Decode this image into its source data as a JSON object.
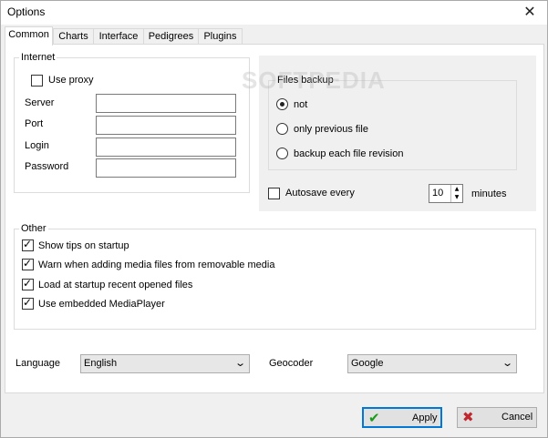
{
  "window": {
    "title": "Options"
  },
  "tabs": [
    "Common",
    "Charts",
    "Interface",
    "Pedigrees",
    "Plugins"
  ],
  "internet": {
    "label": "Internet",
    "use_proxy": "Use proxy",
    "server": "Server",
    "port": "Port",
    "login": "Login",
    "password": "Password"
  },
  "files_backup": {
    "label": "Files backup",
    "options": [
      "not",
      "only previous file",
      "backup each file revision"
    ],
    "selected": "not"
  },
  "autosave": {
    "label": "Autosave every",
    "value": "10",
    "unit": "minutes"
  },
  "other": {
    "label": "Other",
    "items": [
      "Show tips on startup",
      "Warn when adding media files from removable media",
      "Load at startup recent opened files",
      "Use embedded MediaPlayer"
    ]
  },
  "language": {
    "label": "Language",
    "value": "English"
  },
  "geocoder": {
    "label": "Geocoder",
    "value": "Google"
  },
  "buttons": {
    "apply": "Apply",
    "cancel": "Cancel"
  },
  "watermark": "SOFTPEDIA"
}
